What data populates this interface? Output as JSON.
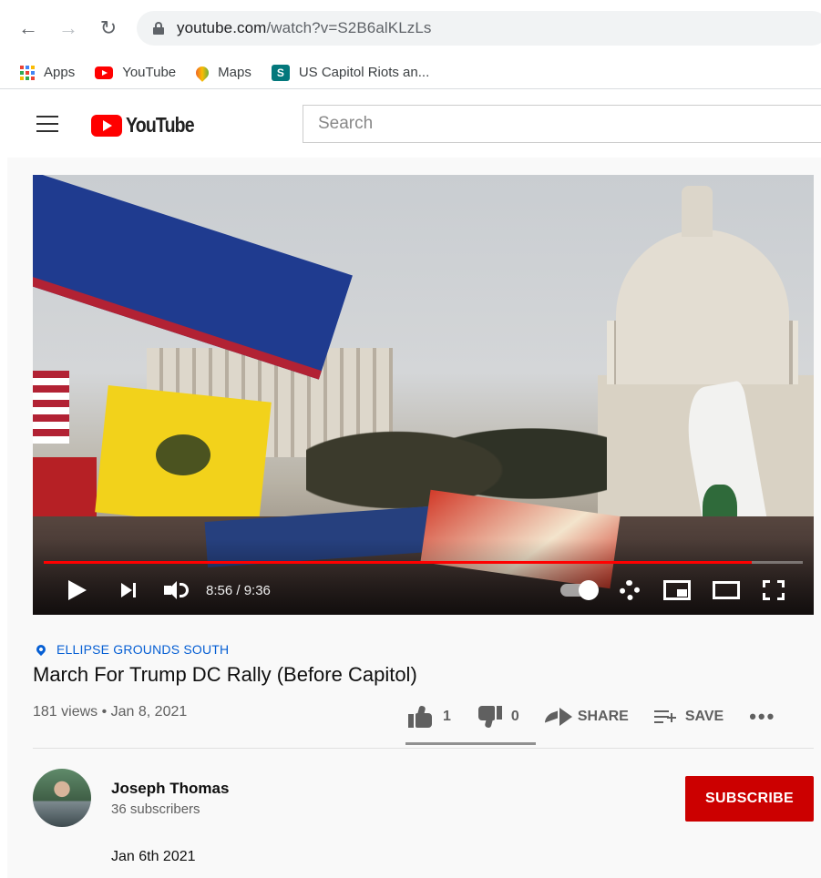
{
  "browser": {
    "url_domain": "youtube.com",
    "url_path": "/watch?v=S2B6alKLzLs",
    "bookmarks": [
      {
        "label": "Apps",
        "icon": "apps-grid-icon"
      },
      {
        "label": "YouTube",
        "icon": "youtube-icon"
      },
      {
        "label": "Maps",
        "icon": "maps-icon"
      },
      {
        "label": "US Capitol Riots an...",
        "icon": "sharepoint-icon"
      }
    ]
  },
  "header": {
    "logo_text": "YouTube",
    "search_placeholder": "Search"
  },
  "player": {
    "time": "8:56 / 9:36",
    "progress_fraction": 0.933,
    "colors": {
      "progress": "#ff0000"
    }
  },
  "video": {
    "location": "ELLIPSE GROUNDS SOUTH",
    "title": "March For Trump DC Rally (Before Capitol)",
    "meta": "181 views • Jan 8, 2021",
    "likes": "1",
    "dislikes": "0",
    "share_label": "SHARE",
    "save_label": "SAVE",
    "more_label": "•••"
  },
  "channel": {
    "name": "Joseph Thomas",
    "subscribers": "36 subscribers",
    "subscribe_label": "SUBSCRIBE",
    "colors": {
      "subscribe": "#cc0000"
    }
  },
  "description": {
    "text": "Jan 6th 2021"
  }
}
